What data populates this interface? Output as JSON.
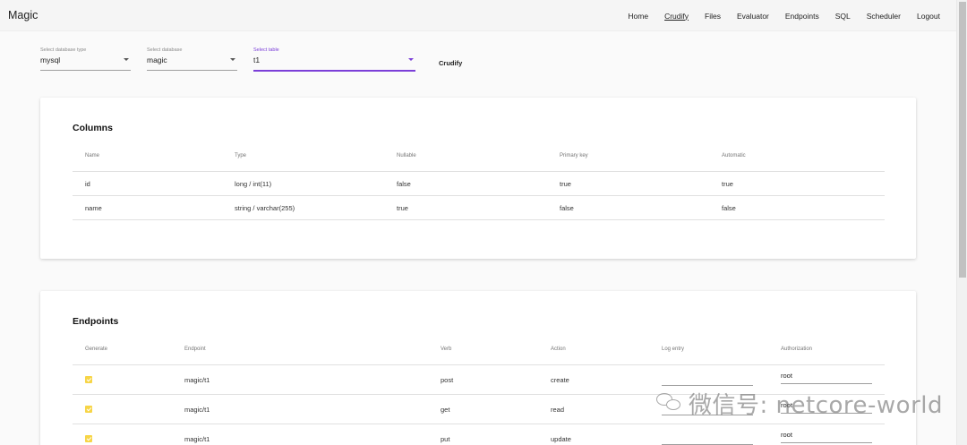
{
  "app": {
    "title": "Magic"
  },
  "nav": {
    "items": [
      {
        "label": "Home",
        "active": false
      },
      {
        "label": "Crudify",
        "active": true
      },
      {
        "label": "Files",
        "active": false
      },
      {
        "label": "Evaluator",
        "active": false
      },
      {
        "label": "Endpoints",
        "active": false
      },
      {
        "label": "SQL",
        "active": false
      },
      {
        "label": "Scheduler",
        "active": false
      },
      {
        "label": "Logout",
        "active": false
      }
    ]
  },
  "selects": {
    "db_type": {
      "label": "Select database type",
      "value": "mysql"
    },
    "database": {
      "label": "Select database",
      "value": "magic"
    },
    "table": {
      "label": "Select table",
      "value": "t1"
    }
  },
  "crudify_button": "Crudify",
  "columns": {
    "title": "Columns",
    "headers": [
      "Name",
      "Type",
      "Nullable",
      "Primary key",
      "Automatic"
    ],
    "rows": [
      [
        "id",
        "long / int(11)",
        "false",
        "true",
        "true"
      ],
      [
        "name",
        "string / varchar(255)",
        "true",
        "false",
        "false"
      ]
    ]
  },
  "endpoints": {
    "title": "Endpoints",
    "headers": [
      "Generate",
      "Endpoint",
      "Verb",
      "Action",
      "Log entry",
      "Authorization"
    ],
    "rows": [
      {
        "generate": true,
        "endpoint": "magic/t1",
        "verb": "post",
        "action": "create",
        "log_entry": "",
        "authorization": "root"
      },
      {
        "generate": true,
        "endpoint": "magic/t1",
        "verb": "get",
        "action": "read",
        "log_entry": "",
        "authorization": "root"
      },
      {
        "generate": true,
        "endpoint": "magic/t1",
        "verb": "put",
        "action": "update",
        "log_entry": "",
        "authorization": "root"
      }
    ]
  },
  "watermark": "微信号: netcore-world",
  "colors": {
    "accent": "#7b3fd8",
    "checkbox": "#f7d547"
  },
  "icons": {
    "dropdown": "chevron-down-icon",
    "checkbox": "checkbox-checked-icon",
    "watermark": "wechat-icon"
  }
}
